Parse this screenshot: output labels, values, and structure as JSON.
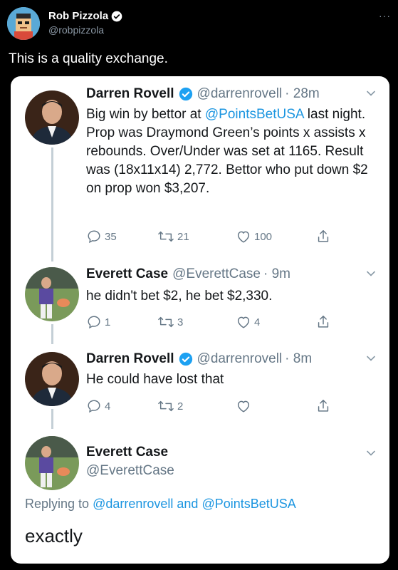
{
  "outer": {
    "name": "Rob Pizzola",
    "handle": "@robpizzola",
    "more": "···",
    "text": "This is a quality exchange."
  },
  "tweets": [
    {
      "name": "Darren Rovell",
      "handle": "@darrenrovell",
      "time": "· 28m",
      "body_parts": [
        "Big win by bettor at ",
        "@PointsBetUSA",
        " last night. Prop was Draymond Green’s points x assists x rebounds. Over/Under was set at 1165. Result was (18x11x14) 2,772. Bettor who put down $2 on prop won $3,207."
      ],
      "replies": "35",
      "retweets": "21",
      "likes": "100"
    },
    {
      "name": "Everett Case",
      "handle": "@EverettCase",
      "time": "· 9m",
      "body": "he didn't bet $2, he bet $2,330.",
      "replies": "1",
      "retweets": "3",
      "likes": "4"
    },
    {
      "name": "Darren Rovell",
      "handle": "@darrenrovell",
      "time": "· 8m",
      "body": "He could have lost that",
      "replies": "4",
      "retweets": "2",
      "likes": ""
    },
    {
      "name": "Everett Case",
      "handle": "@EverettCase"
    }
  ],
  "replying": {
    "prefix": "Replying to ",
    "user1": "@darrenrovell",
    "and": " and ",
    "user2": "@PointsBetUSA"
  },
  "final_text": "exactly",
  "colors": {
    "link": "#1b95e0",
    "verified": "#1da1f2",
    "muted": "#657786"
  }
}
